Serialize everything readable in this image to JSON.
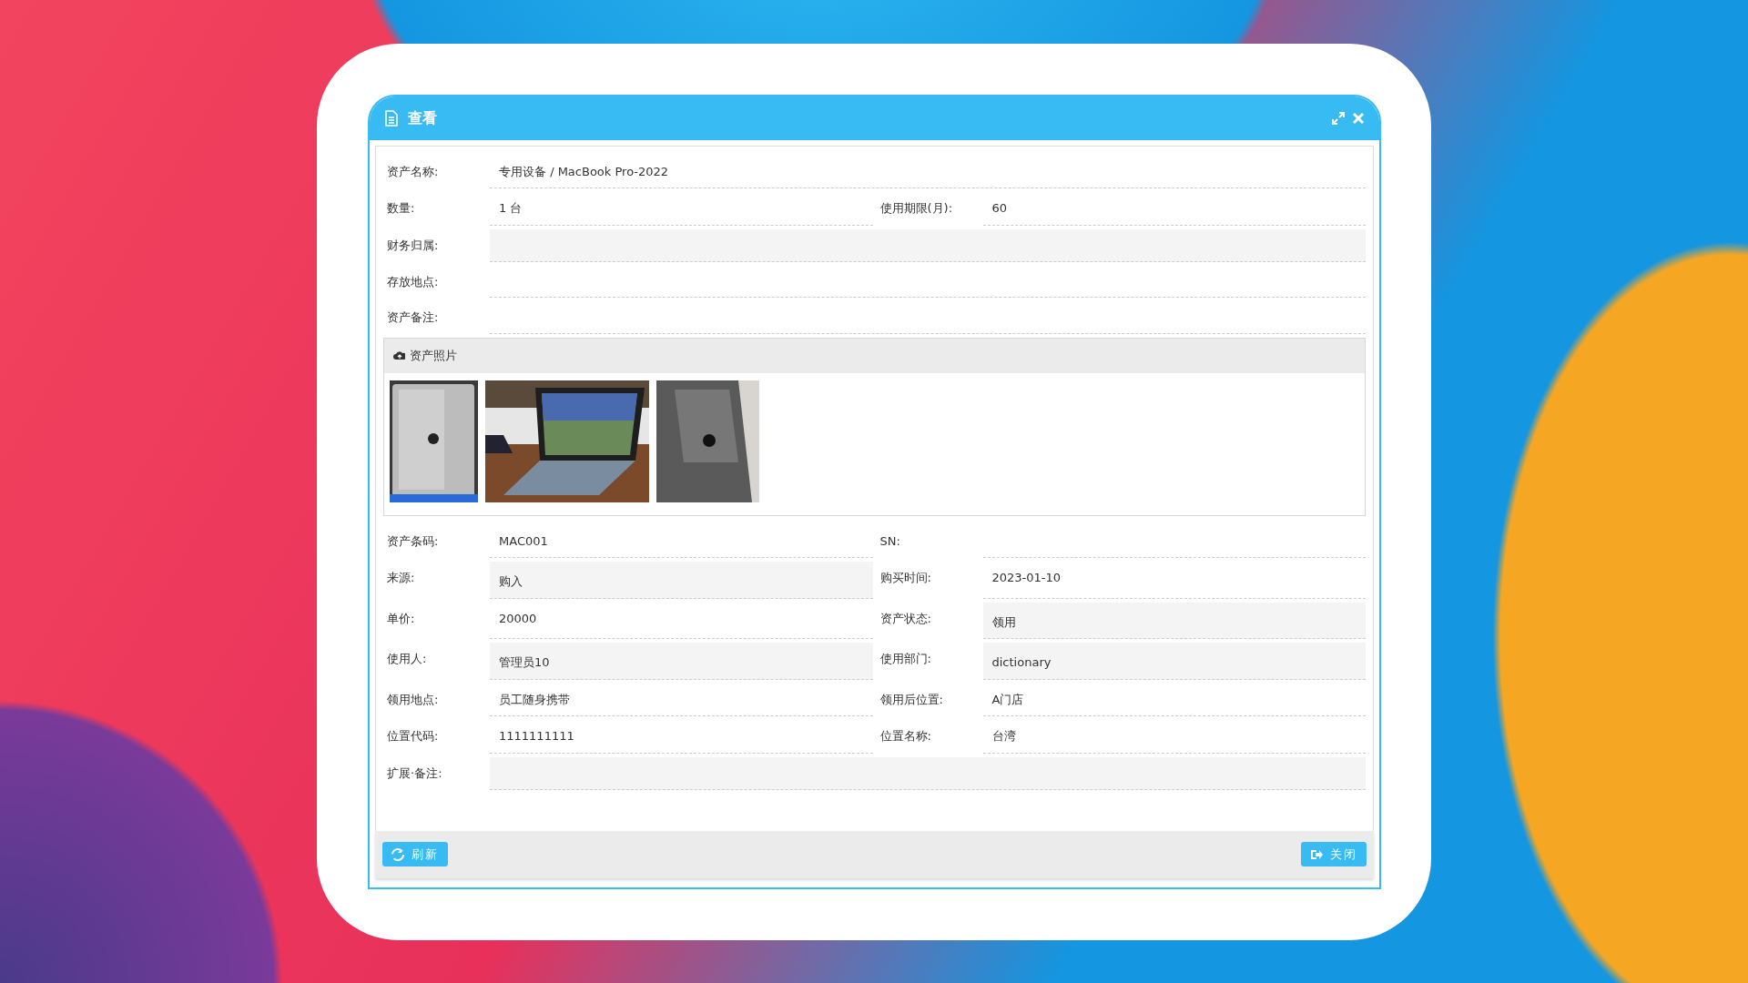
{
  "dialog": {
    "title": "查看"
  },
  "form_top": [
    {
      "label": "资产名称:",
      "value": "专用设备 / MacBook Pro-2022",
      "kind": "text",
      "wide": true
    },
    {
      "label": "数量:",
      "value": "1 台",
      "kind": "text",
      "wide": false
    },
    {
      "label": "使用期限(月):",
      "value": "60",
      "kind": "text",
      "wide": false
    },
    {
      "label": "财务归属:",
      "kind": "select",
      "wide": true
    },
    {
      "label": "存放地点:",
      "kind": "text",
      "wide": true
    },
    {
      "label": "资产备注:",
      "kind": "text",
      "wide": true
    }
  ],
  "photo_panel": {
    "title": "资产照片"
  },
  "form_bottom": [
    {
      "label": "资产条码:",
      "value": "MAC001",
      "kind": "text",
      "wide": false
    },
    {
      "label": "SN:",
      "kind": "text",
      "wide": false
    },
    {
      "label": "来源:",
      "value": "购入",
      "kind": "select",
      "wide": false
    },
    {
      "label": "购买时间:",
      "value": "2023-01-10",
      "kind": "text",
      "wide": false
    },
    {
      "label": "单价:",
      "value": "20000",
      "kind": "text",
      "wide": false
    },
    {
      "label": "资产状态:",
      "value": "领用",
      "kind": "select",
      "wide": false
    },
    {
      "label": "使用人:",
      "value": "管理员10",
      "kind": "select",
      "wide": false
    },
    {
      "label": "使用部门:",
      "value": "dictionary",
      "kind": "select",
      "wide": false
    },
    {
      "label": "领用地点:",
      "value": "员工随身携带",
      "kind": "text",
      "wide": false
    },
    {
      "label": "领用后位置:",
      "value": "A门店",
      "kind": "text",
      "wide": false
    },
    {
      "label": "位置代码:",
      "value": "1111111111",
      "kind": "text",
      "wide": false
    },
    {
      "label": "位置名称:",
      "value": "台湾",
      "kind": "text",
      "wide": false
    },
    {
      "label": "扩展·备注:",
      "kind": "select",
      "wide": true
    }
  ],
  "buttons": [
    {
      "label": "刷新",
      "kind": "refresh"
    },
    {
      "label": "关闭",
      "kind": "close"
    }
  ]
}
